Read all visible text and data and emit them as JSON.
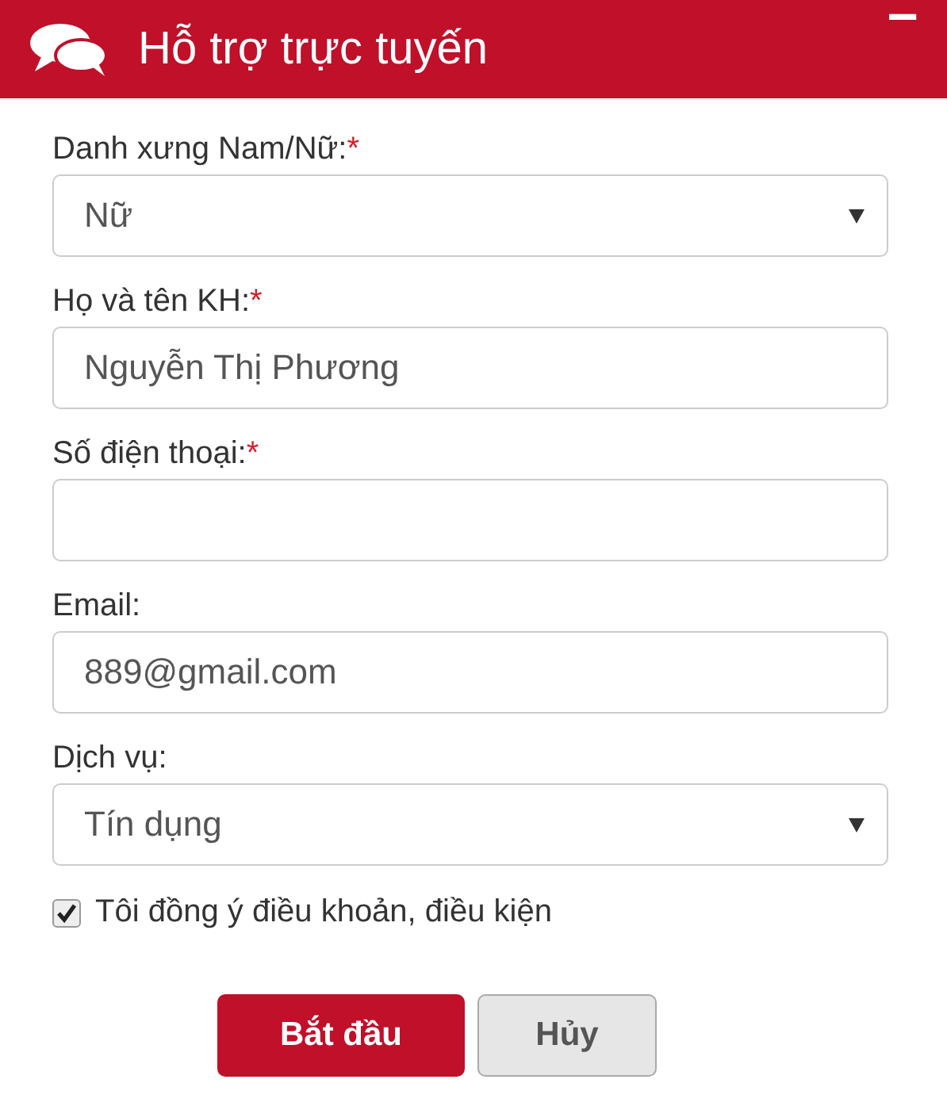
{
  "panel": {
    "title": "Hỗ trợ trực tuyến",
    "minimize": "−"
  },
  "fields": [
    {
      "kind": "select",
      "label": "Danh xưng Nam/Nữ:",
      "mark": "*",
      "value": "Nữ"
    },
    {
      "kind": "text",
      "label": "Họ và tên KH:",
      "mark": "*",
      "value": "Nguyễn Thị Phương"
    },
    {
      "kind": "text",
      "label": "Số điện thoại:",
      "mark": "*"
    },
    {
      "kind": "text",
      "label": "Email:",
      "value": "889@gmail.com"
    },
    {
      "kind": "select",
      "label": "Dịch vụ:",
      "value": "Tín dụng"
    }
  ],
  "agree": {
    "label": "Tôi đồng ý điều khoản, điều kiện",
    "checked": true
  },
  "buttons": [
    {
      "kind": "primary",
      "label": "Bắt đầu"
    },
    {
      "kind": "secondary",
      "label": "Hủy"
    }
  ]
}
